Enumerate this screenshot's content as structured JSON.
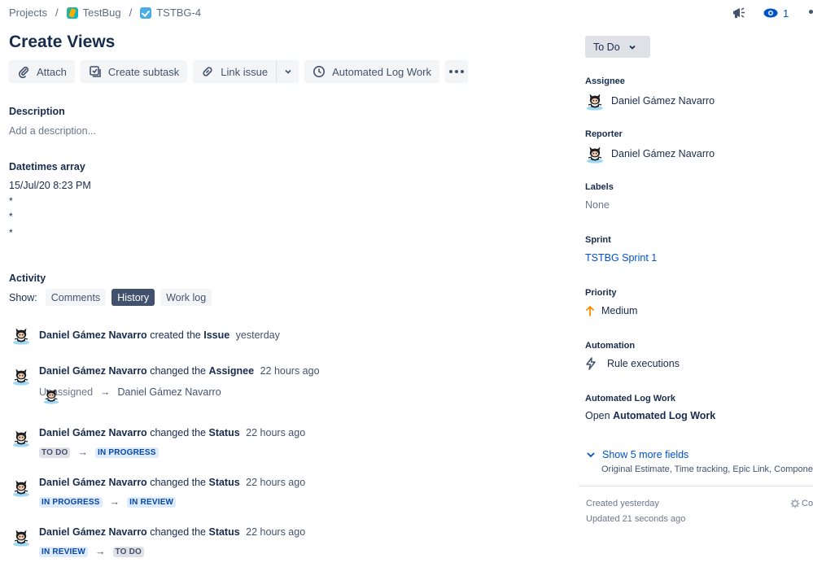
{
  "breadcrumb": {
    "projects": "Projects",
    "sep": "/",
    "project": "TestBug",
    "issue_key": "TSTBG-4"
  },
  "top_right": {
    "watch_count": "1"
  },
  "issue": {
    "title": "Create Views"
  },
  "toolbar": {
    "attach": "Attach",
    "create_subtask": "Create subtask",
    "link_issue": "Link issue",
    "automated_log_work": "Automated Log Work"
  },
  "description": {
    "heading": "Description",
    "placeholder": "Add a description..."
  },
  "datetimes": {
    "heading": "Datetimes array",
    "value": "15/Jul/20 8:23 PM",
    "items": [
      "*",
      "*",
      "*"
    ]
  },
  "activity": {
    "heading": "Activity",
    "show_label": "Show:",
    "tabs": [
      "Comments",
      "History",
      "Work log"
    ],
    "active_tab": "History",
    "arrow": "→",
    "entries": [
      {
        "user": "Daniel Gámez Navarro",
        "action": "created the",
        "field": "Issue",
        "time": "yesterday"
      },
      {
        "user": "Daniel Gámez Navarro",
        "action": "changed the",
        "field": "Assignee",
        "time": "22 hours ago",
        "from": "Unassigned",
        "to": "Daniel Gámez Navarro"
      },
      {
        "user": "Daniel Gámez Navarro",
        "action": "changed the",
        "field": "Status",
        "time": "22 hours ago",
        "from": "TO DO",
        "to": "IN PROGRESS"
      },
      {
        "user": "Daniel Gámez Navarro",
        "action": "changed the",
        "field": "Status",
        "time": "22 hours ago",
        "from": "IN PROGRESS",
        "to": "IN REVIEW"
      },
      {
        "user": "Daniel Gámez Navarro",
        "action": "changed the",
        "field": "Status",
        "time": "22 hours ago",
        "from": "IN REVIEW",
        "to": "TO DO"
      }
    ]
  },
  "sidebar": {
    "status": "To Do",
    "assignee": {
      "label": "Assignee",
      "value": "Daniel Gámez Navarro"
    },
    "reporter": {
      "label": "Reporter",
      "value": "Daniel Gámez Navarro"
    },
    "labels": {
      "label": "Labels",
      "value": "None"
    },
    "sprint": {
      "label": "Sprint",
      "value": "TSTBG Sprint 1"
    },
    "priority": {
      "label": "Priority",
      "value": "Medium"
    },
    "automation": {
      "label": "Automation",
      "value": "Rule executions"
    },
    "automated_log_work": {
      "label": "Automated Log Work",
      "prefix": "Open",
      "value": "Automated Log Work"
    },
    "show_more": "Show 5 more fields",
    "more_fields": "Original Estimate, Time tracking, Epic Link, Components a",
    "created": "Created yesterday",
    "updated": "Updated 21 seconds ago",
    "configure": "Co"
  },
  "colors": {
    "accent": "#0052cc",
    "lozenge_grey": "#dfe1e6",
    "lozenge_blue": "#deebff",
    "priority_medium": "#ff8b00"
  }
}
